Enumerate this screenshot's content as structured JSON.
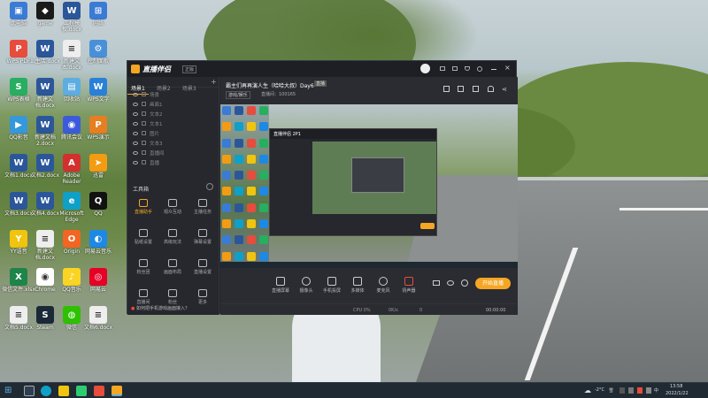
{
  "desktop": {
    "icons": [
      {
        "label": "此电脑",
        "color": "#3a7bd5",
        "glyph": "▣"
      },
      {
        "label": "game",
        "color": "#1a1a1a",
        "glyph": "◆"
      },
      {
        "label": "工程模板.docx",
        "color": "#2b579a",
        "glyph": "W"
      },
      {
        "label": "网络",
        "color": "#3a7bd5",
        "glyph": "⊞"
      },
      {
        "label": "WPS PDF",
        "color": "#e74c3c",
        "glyph": "P"
      },
      {
        "label": "1.生活.docx",
        "color": "#2b579a",
        "glyph": "W"
      },
      {
        "label": "新建文本.docx",
        "color": "#eeeeee",
        "glyph": "≡"
      },
      {
        "label": "控制面板",
        "color": "#4a90d9",
        "glyph": "⚙"
      },
      {
        "label": "WPS表格",
        "color": "#27ae60",
        "glyph": "S"
      },
      {
        "label": "新建文档.docx",
        "color": "#2b579a",
        "glyph": "W"
      },
      {
        "label": "回收站",
        "color": "#5dade2",
        "glyph": "▤"
      },
      {
        "label": "WPS文字",
        "color": "#2980d9",
        "glyph": "W"
      },
      {
        "label": "QQ影音",
        "color": "#3498db",
        "glyph": "▶"
      },
      {
        "label": "新建文档2.docx",
        "color": "#2b579a",
        "glyph": "W"
      },
      {
        "label": "腾讯会议",
        "color": "#3b5bdb",
        "glyph": "◉"
      },
      {
        "label": "WPS演示",
        "color": "#e67e22",
        "glyph": "P"
      },
      {
        "label": "文档1.docx",
        "color": "#2b579a",
        "glyph": "W"
      },
      {
        "label": "文档2.docx",
        "color": "#2b579a",
        "glyph": "W"
      },
      {
        "label": "Adobe Reader",
        "color": "#d32f2f",
        "glyph": "A"
      },
      {
        "label": "迅雷",
        "color": "#f39c12",
        "glyph": "➤"
      },
      {
        "label": "文档3.docx",
        "color": "#2b579a",
        "glyph": "W"
      },
      {
        "label": "文档4.docx",
        "color": "#2b579a",
        "glyph": "W"
      },
      {
        "label": "Microsoft Edge",
        "color": "#0fa0c8",
        "glyph": "e"
      },
      {
        "label": "QQ",
        "color": "#111111",
        "glyph": "Q"
      },
      {
        "label": "YY语音",
        "color": "#f1c40f",
        "glyph": "Y"
      },
      {
        "label": "新建文档.docx",
        "color": "#eeeeee",
        "glyph": "≡"
      },
      {
        "label": "Origin",
        "color": "#f26522",
        "glyph": "O"
      },
      {
        "label": "网易云音乐",
        "color": "#1e88e5",
        "glyph": "◐"
      },
      {
        "label": "微信文件.xlsx",
        "color": "#1e8449",
        "glyph": "X"
      },
      {
        "label": "Chrome",
        "color": "#ffffff",
        "glyph": "◉"
      },
      {
        "label": "QQ音乐",
        "color": "#f9d423",
        "glyph": "♪"
      },
      {
        "label": "网易云",
        "color": "#e60026",
        "glyph": "◎"
      },
      {
        "label": "文档5.docx",
        "color": "#eeeeee",
        "glyph": "≡"
      },
      {
        "label": "Steam",
        "color": "#1b2838",
        "glyph": "S"
      },
      {
        "label": "微信",
        "color": "#2dc100",
        "glyph": "◍"
      },
      {
        "label": "文档6.docx",
        "color": "#eeeeee",
        "glyph": "≡"
      }
    ]
  },
  "app": {
    "logo": "直播伴侣",
    "version": "正版",
    "left_tabs": [
      "场景1",
      "场景2",
      "场景3"
    ],
    "scenes": [
      "场景",
      "画面1",
      "文本2",
      "文本1",
      "图片",
      "文本3",
      "直播间",
      "直播",
      "背景",
      "弹幕"
    ],
    "tools_title": "工具箱",
    "tools": [
      "直播助手",
      "观众互动",
      "主播任务",
      "贴纸设置",
      "高级玩法",
      "弹幕设置",
      "粉丝团",
      "画面布局",
      "直播设置",
      "直播间",
      "粉丝",
      "更多"
    ],
    "bottom_tip": "如何把手机游戏画面接入？",
    "stream_title": "霸主们再再演人生（哈哈大叔）Day6",
    "stream_badge": "直播",
    "category_btn": "游戏/娱乐",
    "room_id": "直播间：100165",
    "preview_title": "直播伴侣 2P1",
    "controls": [
      "直播屏幕",
      "摄像头",
      "手机投屏",
      "多媒体",
      "麦克风",
      "扬声器"
    ],
    "start_btn": "开始直播",
    "status": [
      "CPU 0%",
      "0K/s",
      "0",
      "00:00:00"
    ],
    "left_status": [
      "CPU 5%"
    ]
  },
  "taskbar": {
    "temp": "-2°C",
    "weather": "雪",
    "time": "13:58",
    "date": "2022/1/22",
    "lang": "中"
  }
}
